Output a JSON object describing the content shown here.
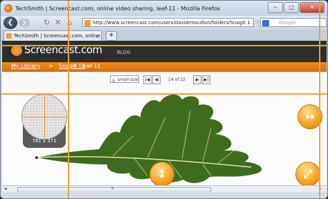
{
  "window": {
    "title": "TechSmith | Screencast.com, online video sharing, leaf-11 - Mozilla Firefox",
    "min": "‒",
    "max": "□",
    "close": "✕"
  },
  "nav": {
    "back": "❮",
    "forward": "❯",
    "reload": "↻",
    "stop": "✕",
    "home": "⌂",
    "url": "http://www.screencast.com/users/davidrmoulton/folders/Snagit 1",
    "bookmark": "☆",
    "search_placeholder": "Google"
  },
  "tabs": [
    {
      "label": "TechSmith | Screencast.com, online ...",
      "close": "×"
    }
  ],
  "newtab": "+",
  "site": {
    "logo": "Screencast.com",
    "blog": "BLOG",
    "breadcrumb": {
      "root": "My Library",
      "sep1": ">",
      "folder": "Snagit 11",
      "sep2": ">",
      "current": "leaf-11"
    }
  },
  "toolbar": {
    "zoom_value": "small size",
    "page_label": "14 of 22",
    "first": "|◀",
    "prev": "◀",
    "next": "▶",
    "last": "▶|"
  },
  "magnifier": {
    "dimensions": "781 x 371"
  },
  "orbs": {
    "horizontal": "↔",
    "vertical": "↕",
    "diagonal": "⤢"
  },
  "scroll": {
    "left": "◂",
    "right": "▸",
    "grip": "≡"
  },
  "colors": {
    "accent": "#f08a1e",
    "header": "#2d2d2d",
    "leaf": "#3f6b1e"
  }
}
